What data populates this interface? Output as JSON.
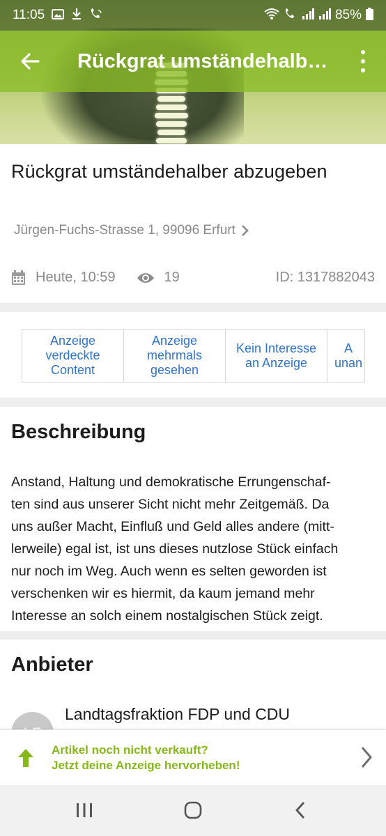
{
  "status_bar": {
    "time": "11:05",
    "left_icons": [
      "image-icon",
      "download-icon",
      "wifi-call-icon"
    ],
    "right_icons": [
      "wifi-icon",
      "wifi-call-icon",
      "signal-icon",
      "signal-icon"
    ],
    "battery": "85%"
  },
  "toolbar": {
    "title": "Rückgrat umständehalbe…",
    "back_icon": "arrow-left-icon",
    "more_icon": "more-vertical-icon",
    "color": "#8cbe28"
  },
  "ad": {
    "title": "Rückgrat umständehalber abzugeben",
    "address": "Jürgen-Fuchs-Strasse 1, 99096 Erfurt",
    "date": "Heute, 10:59",
    "views": "19",
    "id": "ID: 1317882043"
  },
  "report_actions": [
    {
      "label": "Anzeige\nverdeckte\nContent"
    },
    {
      "label": "Anzeige\nmehrmals\ngesehen"
    },
    {
      "label": "Kein Interesse\nan Anzeige"
    },
    {
      "label": "A\nunan"
    }
  ],
  "description": {
    "heading": "Beschreibung",
    "text": "Anstand, Haltung und demokratische Errungenschaf-\nten sind aus unserer Sicht nicht mehr Zeitgemäß. Da\nuns außer Macht, Einfluß und Geld alles andere (mitt-\nlerweile) egal ist, ist uns dieses nutzlose Stück einfach\nnur noch im Weg. Auch wenn es selten geworden ist\nverschenken wir es hiermit, da kaum jemand mehr\nInteresse an solch einem nostalgischen Stück zeigt."
  },
  "seller": {
    "heading": "Anbieter",
    "name": "Landtagsfraktion FDP und CDU",
    "avatar_initials": "LF"
  },
  "promo": {
    "line1": "Artikel noch nicht verkauft?",
    "line2": "Jetzt deine Anzeige hervorheben!",
    "color": "#86b817"
  },
  "nav_bar": {
    "recents_icon": "recents-icon",
    "home_icon": "home-icon",
    "back_icon": "nav-back-icon"
  },
  "colors": {
    "link_blue": "#2f74c8",
    "meta_gray": "#8a8a8a"
  }
}
